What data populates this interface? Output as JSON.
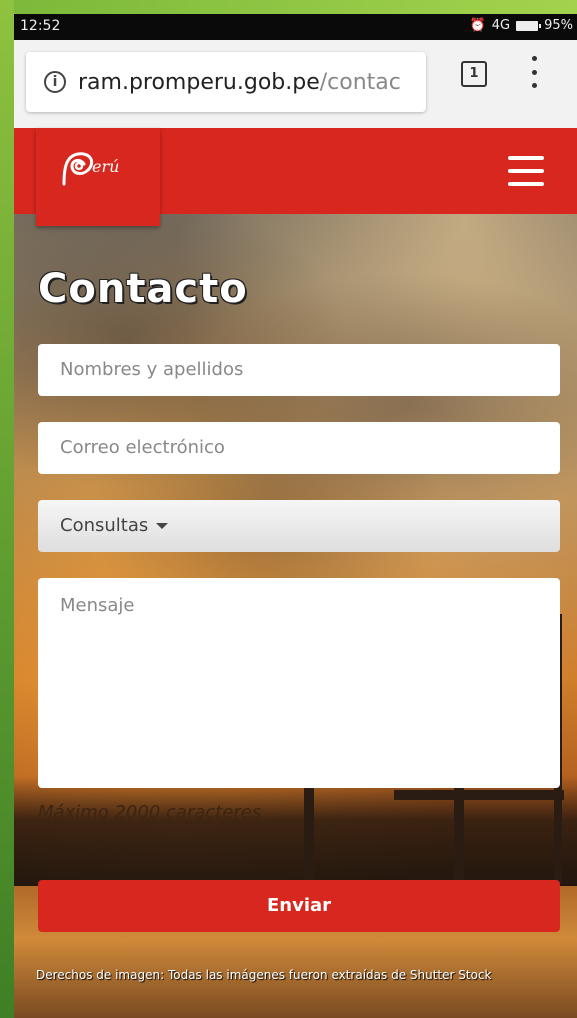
{
  "status_bar": {
    "time": "12:52",
    "network": "4G",
    "battery": "95%"
  },
  "browser": {
    "url_host": "ram.promperu.gob.pe",
    "url_path": "/contac",
    "tab_count": "1"
  },
  "header": {
    "logo_text": "erú"
  },
  "page": {
    "title": "Contacto",
    "form": {
      "name_placeholder": "Nombres y apellidos",
      "email_placeholder": "Correo electrónico",
      "topic_selected": "Consultas",
      "message_placeholder": "Mensaje",
      "max_note": "Máximo 2000 caracteres",
      "submit_label": "Enviar"
    },
    "credits": "Derechos de imagen: Todas las imágenes fueron extraídas de Shutter Stock"
  },
  "colors": {
    "brand_red": "#d8271e"
  }
}
